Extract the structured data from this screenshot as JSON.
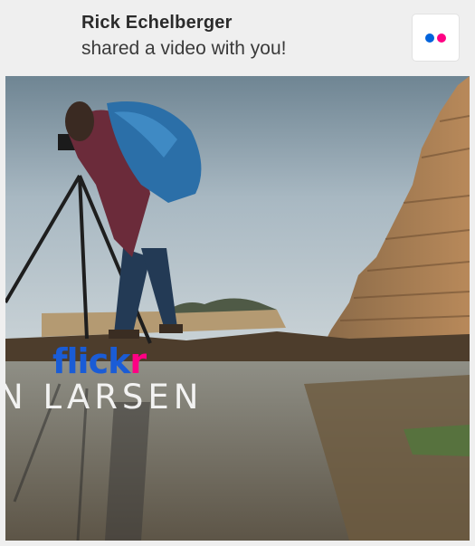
{
  "notification": {
    "sender_name": "Rick Echelberger",
    "message": "shared a video with you!"
  },
  "app_icon": {
    "name": "flickr-dots-icon",
    "colors": [
      "#0063dc",
      "#ff0084"
    ]
  },
  "video_thumbnail": {
    "logo_part1": "flick",
    "logo_part2": "r",
    "overlay_text": "N LARSEN"
  },
  "colors": {
    "flickr_blue": "#0063dc",
    "flickr_pink": "#ff0084",
    "background": "#efefef"
  }
}
